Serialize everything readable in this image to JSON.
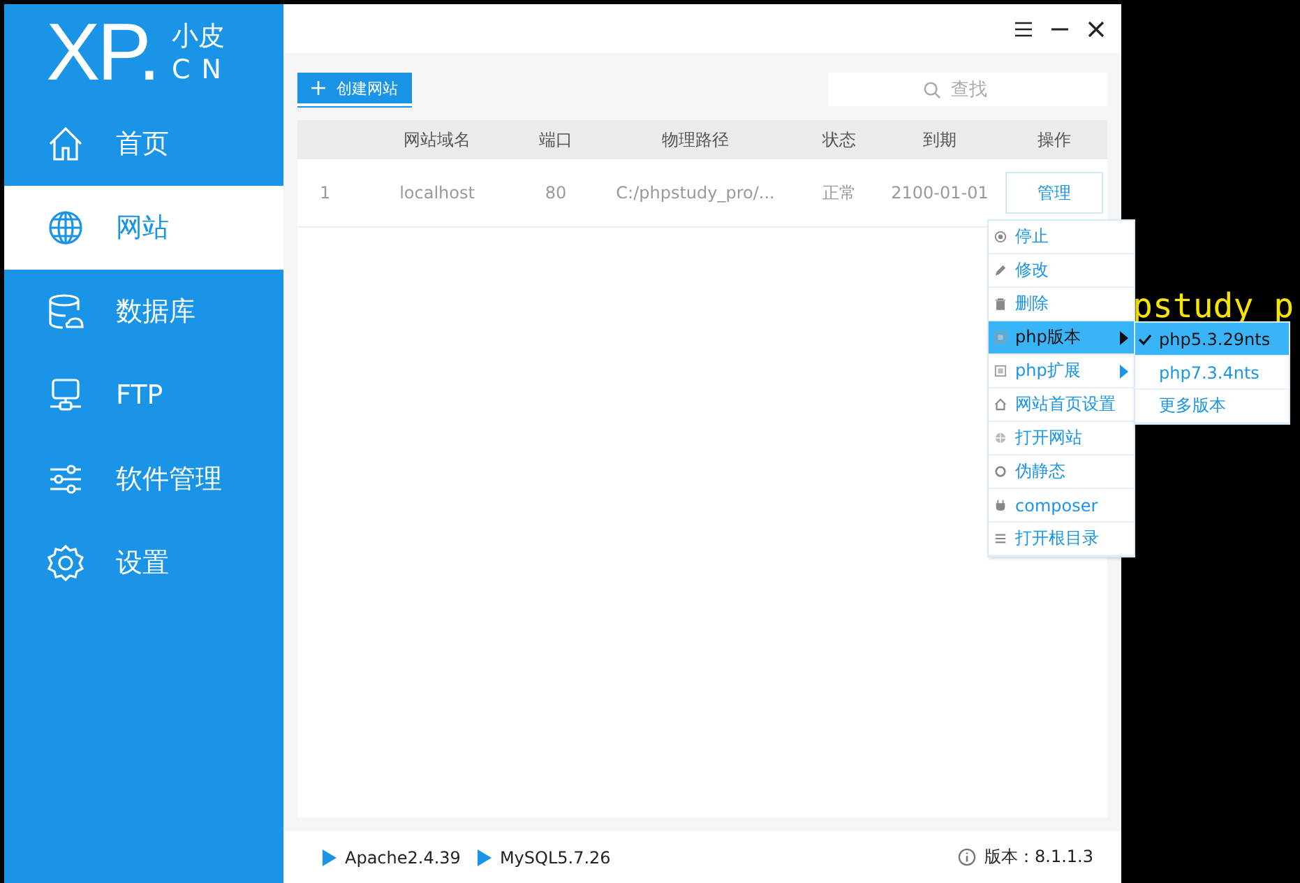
{
  "terminal_text": [
    "pstudy_p"
  ],
  "logo": {
    "mark": "XP.",
    "top": "小皮",
    "bottom": "CN"
  },
  "sidebar": {
    "items": [
      {
        "label": "首页",
        "selected": false
      },
      {
        "label": "网站",
        "selected": true
      },
      {
        "label": "数据库",
        "selected": false
      },
      {
        "label": "FTP",
        "selected": false
      },
      {
        "label": "软件管理",
        "selected": false
      },
      {
        "label": "设置",
        "selected": false
      }
    ]
  },
  "toolbar": {
    "create_button": "创建网站",
    "search": {
      "placeholder": "查找"
    }
  },
  "table": {
    "columns": [
      "网站域名",
      "端口",
      "物理路径",
      "状态",
      "到期",
      "操作"
    ],
    "rows": [
      {
        "index": "1",
        "domain": "localhost",
        "port": "80",
        "path": "C:/phpstudy_pro/...",
        "status": "正常",
        "expiry": "2100-01-01",
        "action": "管理"
      }
    ]
  },
  "context_menu": {
    "items": [
      {
        "label": "停止",
        "selected": false,
        "submenu": false
      },
      {
        "label": "修改",
        "selected": false,
        "submenu": false
      },
      {
        "label": "删除",
        "selected": false,
        "submenu": false
      },
      {
        "label": "php版本",
        "selected": true,
        "submenu": true
      },
      {
        "label": "php扩展",
        "selected": false,
        "submenu": true
      },
      {
        "label": "网站首页设置",
        "selected": false,
        "submenu": false
      },
      {
        "label": "打开网站",
        "selected": false,
        "submenu": false
      },
      {
        "label": "伪静态",
        "selected": false,
        "submenu": false
      },
      {
        "label": "composer",
        "selected": false,
        "submenu": false
      },
      {
        "label": "打开根目录",
        "selected": false,
        "submenu": false
      }
    ],
    "submenu": [
      {
        "label": "php5.3.29nts",
        "checked": true
      },
      {
        "label": "php7.3.4nts",
        "checked": false
      },
      {
        "label": "更多版本",
        "checked": false
      }
    ]
  },
  "status_bar": {
    "services": [
      "Apache2.4.39",
      "MySQL5.7.26"
    ],
    "version": "版本：8.1.1.3"
  }
}
